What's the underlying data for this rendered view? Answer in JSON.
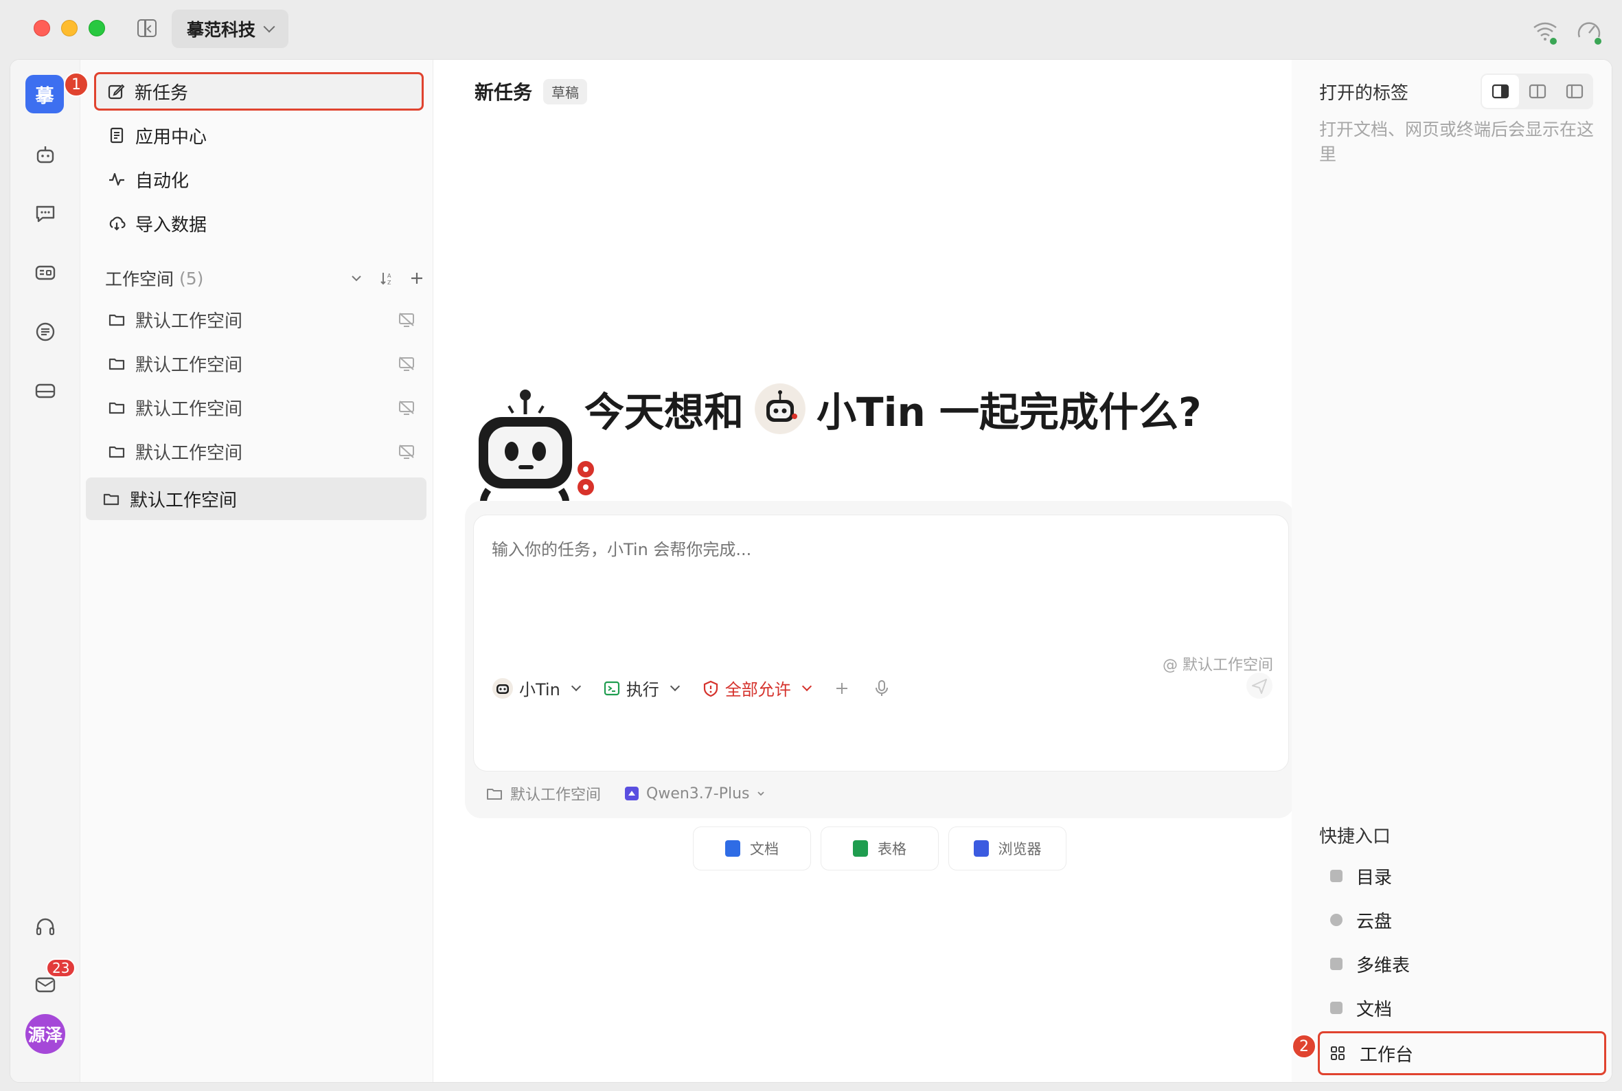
{
  "titlebar": {
    "org_name": "摹范科技"
  },
  "rail": {
    "logo_text": "摹",
    "mail_badge": "23",
    "avatar_text": "源泽"
  },
  "nav": {
    "primary": [
      {
        "label": "新任务",
        "icon": "edit-icon"
      },
      {
        "label": "应用中心",
        "icon": "document-icon"
      },
      {
        "label": "自动化",
        "icon": "activity-icon"
      },
      {
        "label": "导入数据",
        "icon": "cloud-download-icon"
      }
    ],
    "workspace_header": "工作空间",
    "workspace_count": "(5)",
    "workspaces": [
      {
        "label": "默认工作空间"
      },
      {
        "label": "默认工作空间"
      },
      {
        "label": "默认工作空间"
      },
      {
        "label": "默认工作空间"
      },
      {
        "label": "默认工作空间"
      }
    ]
  },
  "steps": {
    "one": "1",
    "two": "2"
  },
  "center": {
    "task_title": "新任务",
    "draft_tag": "草稿",
    "hero_prefix": "今天想和",
    "hero_suffix": "小Tin 一起完成什么?",
    "input_placeholder": "输入你的任务，小Tin 会帮你完成...",
    "composer_workspace": "@ 默认工作空间",
    "agent_label": "小Tin",
    "mode_label": "执行",
    "permission_label": "全部允许",
    "footer_workspace": "默认工作空间",
    "model_label": "Qwen3.7-Plus",
    "quick_buttons": [
      {
        "label": "文档",
        "color": "#2f6ce5"
      },
      {
        "label": "表格",
        "color": "#1f9d4f"
      },
      {
        "label": "浏览器",
        "color": "#3b5be0"
      }
    ]
  },
  "right": {
    "title": "打开的标签",
    "empty_text": "打开文档、网页或终端后会显示在这里",
    "quick_entry_title": "快捷入口",
    "quick_entries": [
      {
        "label": "目录"
      },
      {
        "label": "云盘"
      },
      {
        "label": "多维表"
      },
      {
        "label": "文档"
      },
      {
        "label": "工作台"
      }
    ]
  },
  "colors": {
    "accent": "#3d6ff0",
    "highlight": "#e0432f",
    "danger": "#d5322c"
  }
}
